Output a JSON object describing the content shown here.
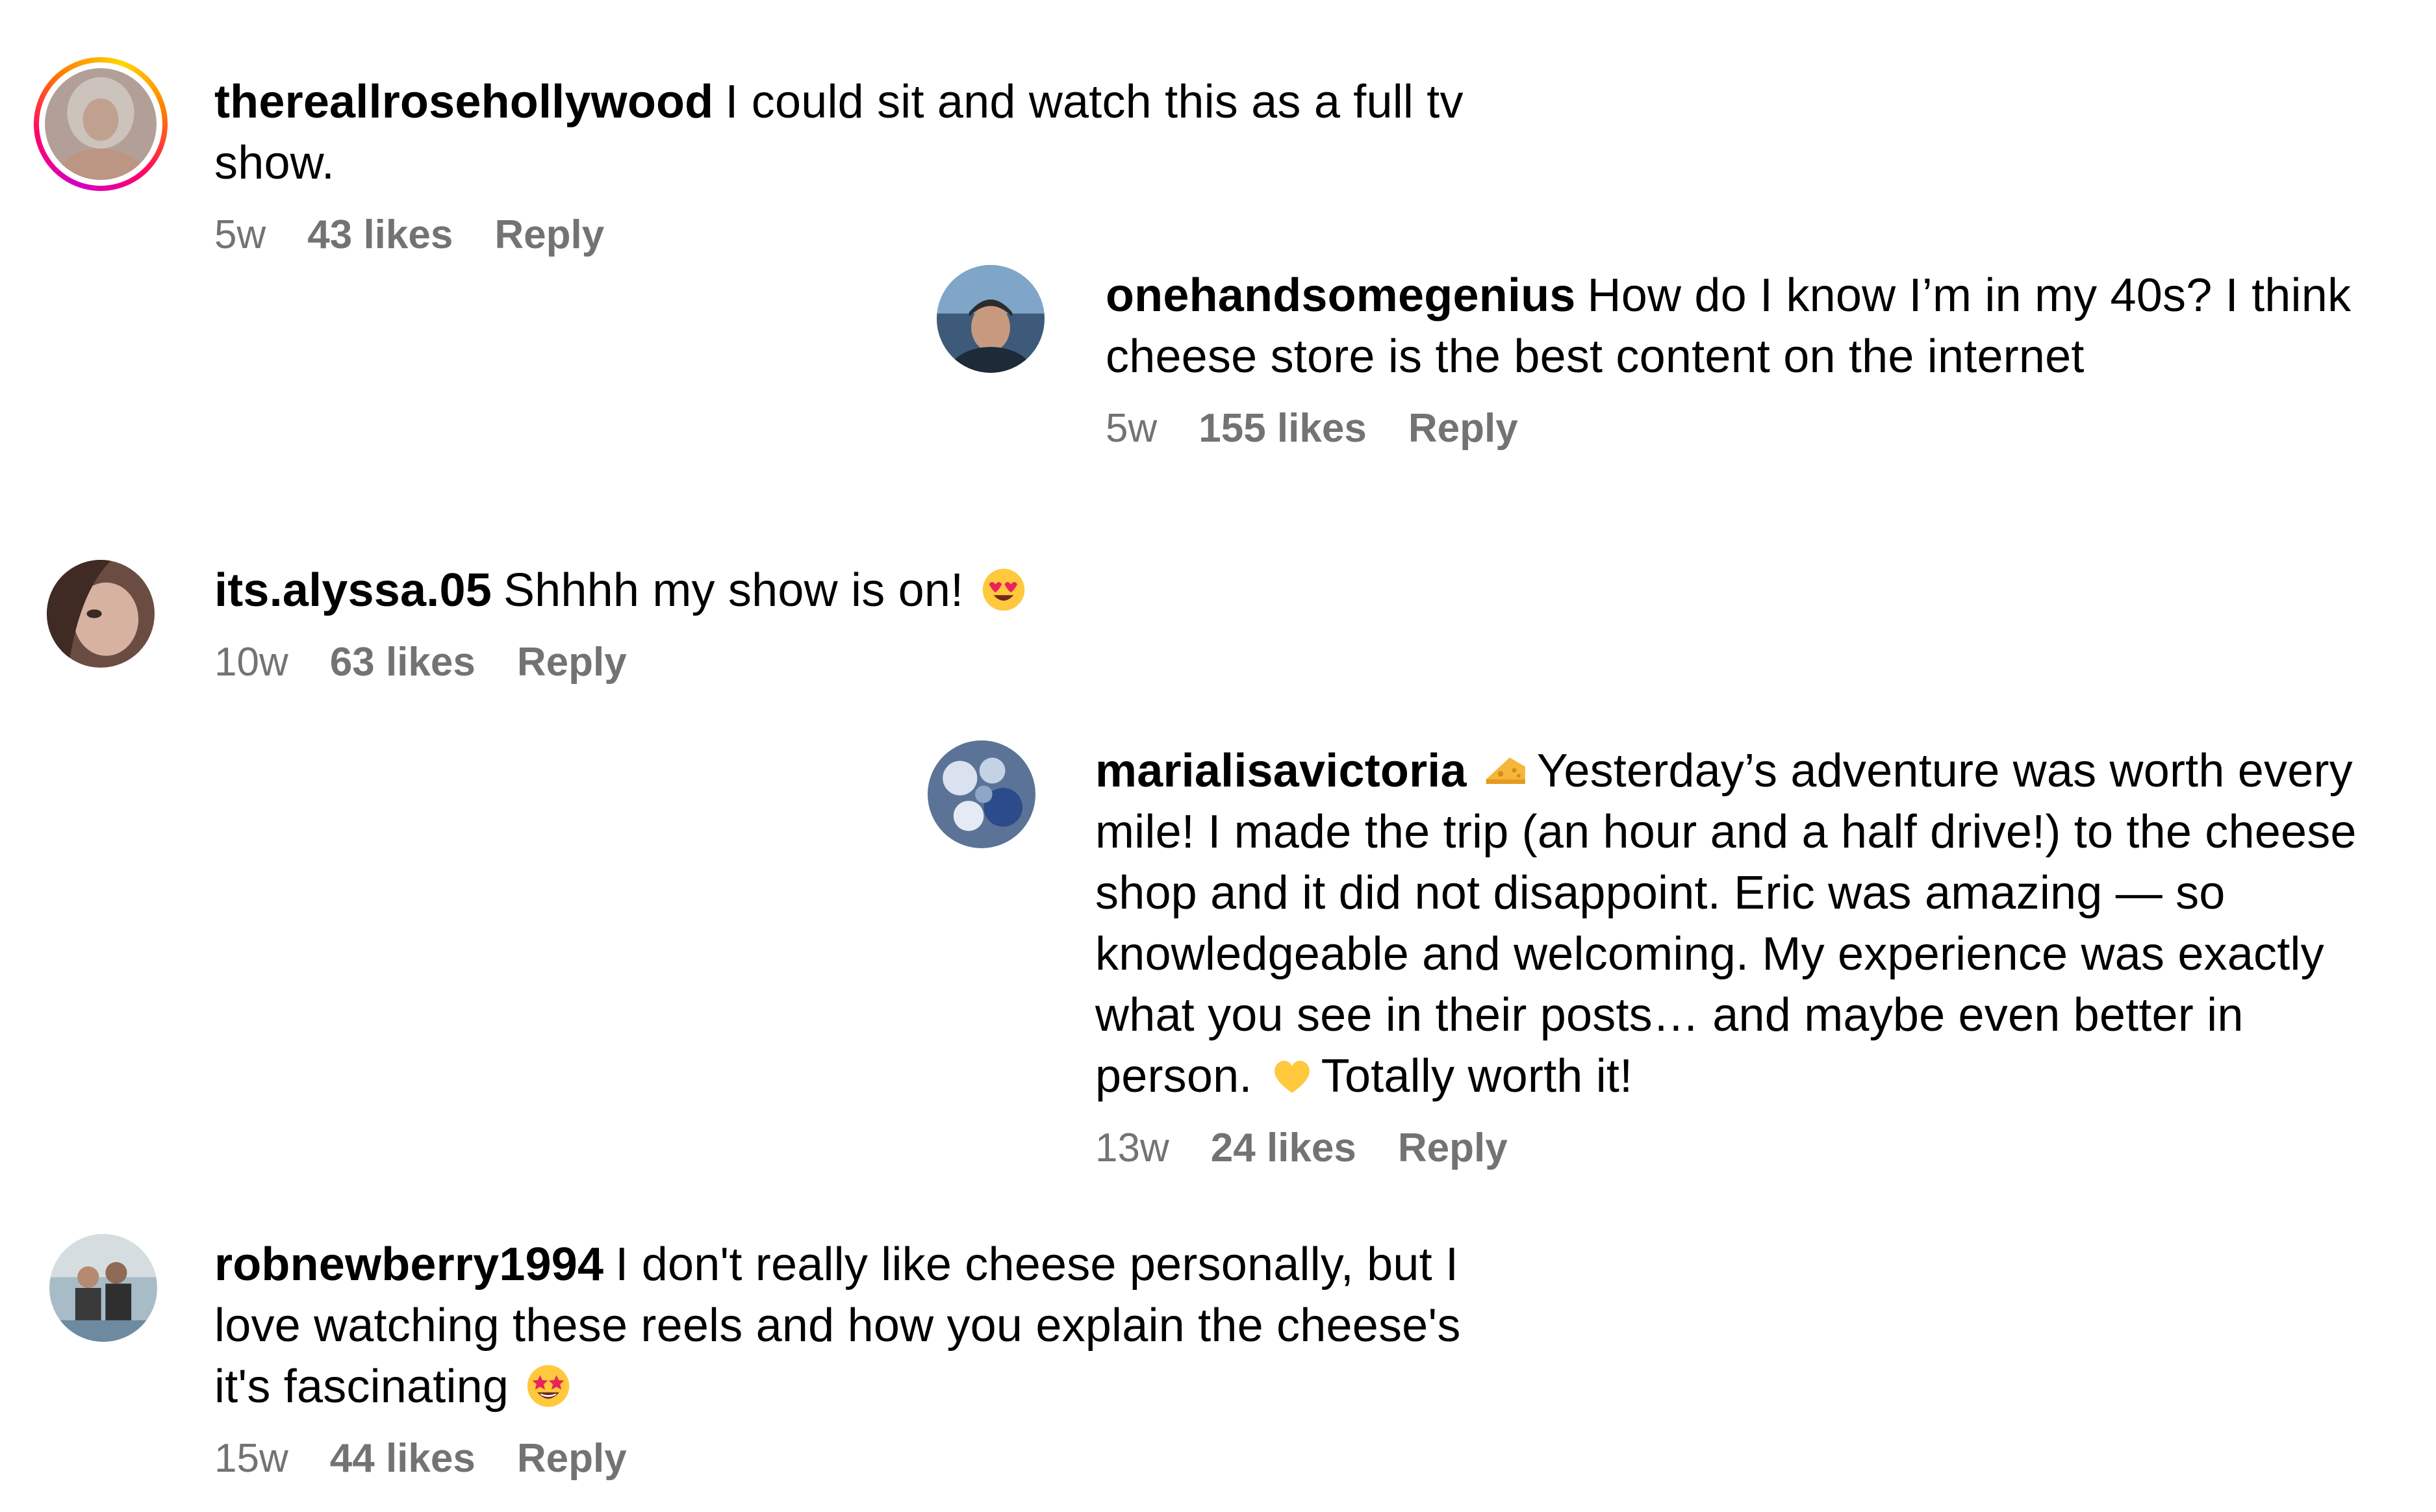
{
  "comments": [
    {
      "username": "thereallrosehollywood",
      "text_line1": "I could sit and watch this as a full tv",
      "text_line2": "show.",
      "time": "5w",
      "likes": "43 likes",
      "reply": "Reply"
    },
    {
      "username": "onehandsomegenius",
      "text_line1": "How do I know I’m in my 40s? I think",
      "text_line2": "cheese store is the best content on the internet",
      "time": "5w",
      "likes": "155 likes",
      "reply": "Reply"
    },
    {
      "username": "its.alyssa.05",
      "text_line1": "Shhhh my show is on!",
      "emoji": "heart-eyes-emoji",
      "time": "10w",
      "likes": "63 likes",
      "reply": "Reply"
    },
    {
      "username": "marialisavictoria",
      "emoji": "cheese-emoji",
      "text_line1": "Yesterday’s adventure was worth every",
      "text_line2": "mile! I made the trip (an hour and a half drive!) to the cheese",
      "text_line3": "shop and it did not disappoint. Eric was amazing — so",
      "text_line4": "knowledgeable and welcoming. My experience was exactly",
      "text_line5": "what you see in their posts… and maybe even better in",
      "text_line6a": "person.",
      "emoji2": "yellow-heart-emoji",
      "text_line6b": "Totally worth it!",
      "time": "13w",
      "likes": "24 likes",
      "reply": "Reply"
    },
    {
      "username": "robnewberry1994",
      "text_line1": "I don't really like cheese personally, but I",
      "text_line2": "love watching these reels and how you explain the cheese's",
      "text_line3": "it's fascinating",
      "emoji": "star-struck-emoji",
      "time": "15w",
      "likes": "44 likes",
      "reply": "Reply"
    }
  ],
  "colors": {
    "text": "#000000",
    "meta": "#737373",
    "story_ring": [
      "#d300c5",
      "#ff0169",
      "#ff7a00",
      "#ffd600"
    ]
  }
}
